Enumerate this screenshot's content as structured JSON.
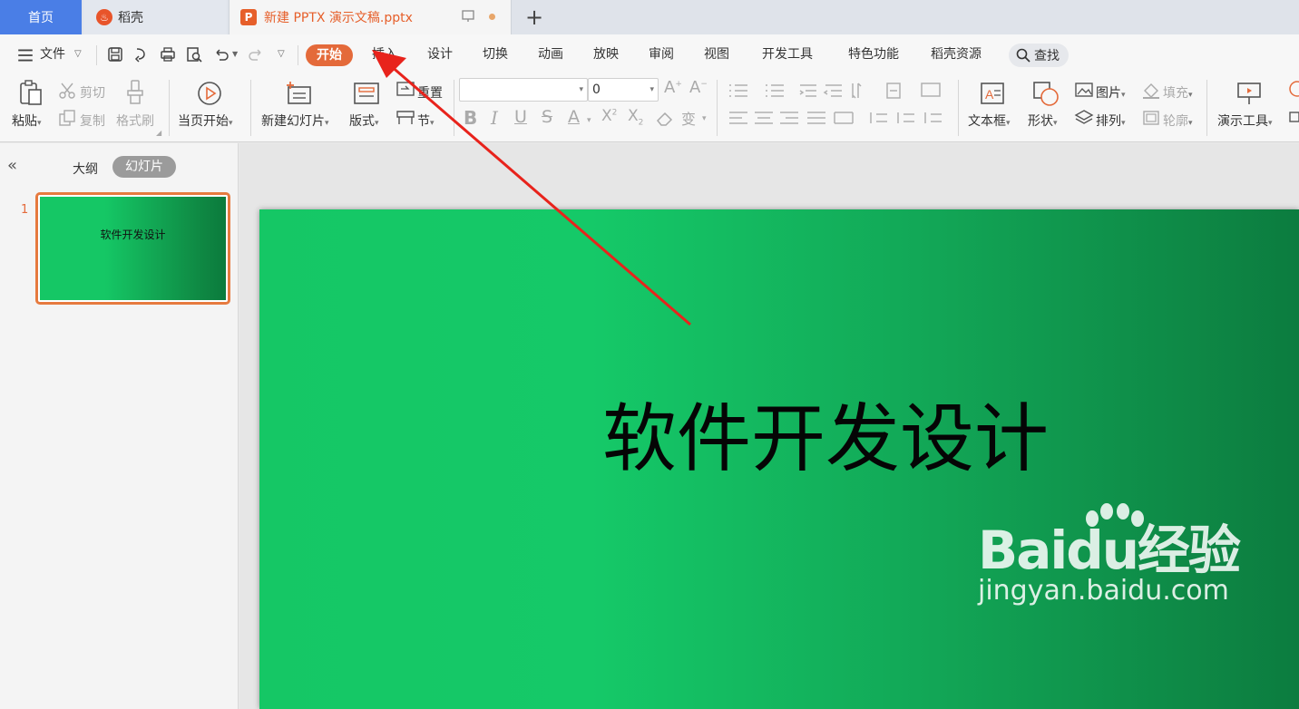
{
  "tabs": {
    "home": "首页",
    "daoke": "稻壳",
    "doc": "新建 PPTX 演示文稿.pptx",
    "add": "+"
  },
  "menu": {
    "file": "文件",
    "items": [
      "开始",
      "插入",
      "设计",
      "切换",
      "动画",
      "放映",
      "审阅",
      "视图",
      "开发工具",
      "特色功能",
      "稻壳资源"
    ],
    "search": "查找"
  },
  "ribbon": {
    "paste": "粘贴",
    "cut": "剪切",
    "copy": "复制",
    "format_painter": "格式刷",
    "from_current": "当页开始",
    "new_slide": "新建幻灯片",
    "layout": "版式",
    "reset": "重置",
    "section": "节",
    "font_size": "0",
    "textbox": "文本框",
    "shape": "形状",
    "picture": "图片",
    "arrange": "排列",
    "fill": "填充",
    "outline": "轮廓",
    "presentation_tools": "演示工具"
  },
  "leftpane": {
    "outline": "大纲",
    "slides": "幻灯片",
    "slide_number": "1",
    "thumb_title": "软件开发设计"
  },
  "slide": {
    "title": "软件开发设计"
  },
  "watermark": {
    "logo": "Baidu经验",
    "url": "jingyan.baidu.com"
  },
  "colors": {
    "accent": "#e46a3a",
    "home_tab": "#4a7ee6",
    "slide_green": "#15c765",
    "slide_dark_green": "#0b7a3c",
    "annotation_arrow": "#e8231c"
  }
}
